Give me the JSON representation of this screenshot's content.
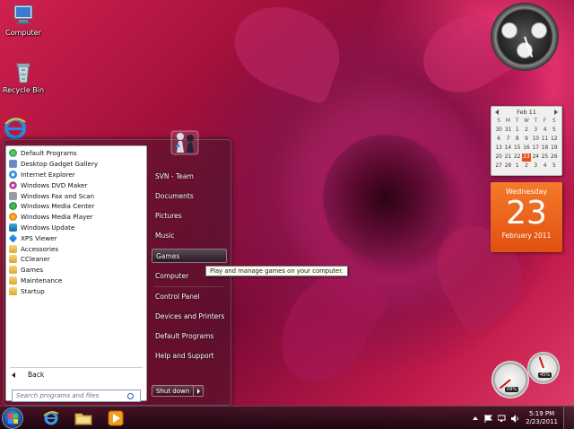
{
  "desktop": {
    "icons": [
      {
        "label": "Computer"
      },
      {
        "label": "Recycle Bin"
      },
      {
        "label": "Internet Explorer"
      }
    ]
  },
  "start_menu": {
    "programs": [
      {
        "label": "Default Programs",
        "icon": "default-programs-icon"
      },
      {
        "label": "Desktop Gadget Gallery",
        "icon": "gadget-gallery-icon"
      },
      {
        "label": "Internet Explorer",
        "icon": "ie-icon"
      },
      {
        "label": "Windows DVD Maker",
        "icon": "dvd-maker-icon"
      },
      {
        "label": "Windows Fax and Scan",
        "icon": "fax-scan-icon"
      },
      {
        "label": "Windows Media Center",
        "icon": "media-center-icon"
      },
      {
        "label": "Windows Media Player",
        "icon": "media-player-icon"
      },
      {
        "label": "Windows Update",
        "icon": "windows-update-icon"
      },
      {
        "label": "XPS Viewer",
        "icon": "xps-viewer-icon"
      },
      {
        "label": "Accessories",
        "icon": "folder-icon"
      },
      {
        "label": "CCleaner",
        "icon": "folder-icon"
      },
      {
        "label": "Games",
        "icon": "folder-icon"
      },
      {
        "label": "Maintenance",
        "icon": "folder-icon"
      },
      {
        "label": "Startup",
        "icon": "folder-icon"
      }
    ],
    "back_label": "Back",
    "search_placeholder": "Search programs and files",
    "right_items": [
      {
        "label": "SVN - Team"
      },
      {
        "label": "Documents"
      },
      {
        "label": "Pictures"
      },
      {
        "label": "Music"
      },
      {
        "label": "Games",
        "highlighted": true
      },
      {
        "label": "Computer"
      },
      {
        "label": "Control Panel"
      },
      {
        "label": "Devices and Printers"
      },
      {
        "label": "Default Programs"
      },
      {
        "label": "Help and Support"
      }
    ],
    "shutdown_label": "Shut down",
    "tooltip": "Play and manage games on your computer."
  },
  "calendar_gadget": {
    "month_label": "Feb 11",
    "days_of_week": [
      "S",
      "M",
      "T",
      "W",
      "T",
      "F",
      "S"
    ],
    "days": [
      "30",
      "31",
      "1",
      "2",
      "3",
      "4",
      "5",
      "6",
      "7",
      "8",
      "9",
      "10",
      "11",
      "12",
      "13",
      "14",
      "15",
      "16",
      "17",
      "18",
      "19",
      "20",
      "21",
      "22",
      "23",
      "24",
      "25",
      "26",
      "27",
      "28",
      "1",
      "2",
      "3",
      "4",
      "5"
    ],
    "today": "23"
  },
  "date_card": {
    "weekday": "Wednesday",
    "day": "23",
    "month_year": "February 2011"
  },
  "meters": {
    "cpu_label": "09%",
    "ram_label": "45%"
  },
  "taskbar": {
    "time": "5:19 PM",
    "date": "2/23/2011"
  },
  "colors": {
    "accent_orange": "#e8501a",
    "wallpaper_magenta": "#a01a5a"
  }
}
